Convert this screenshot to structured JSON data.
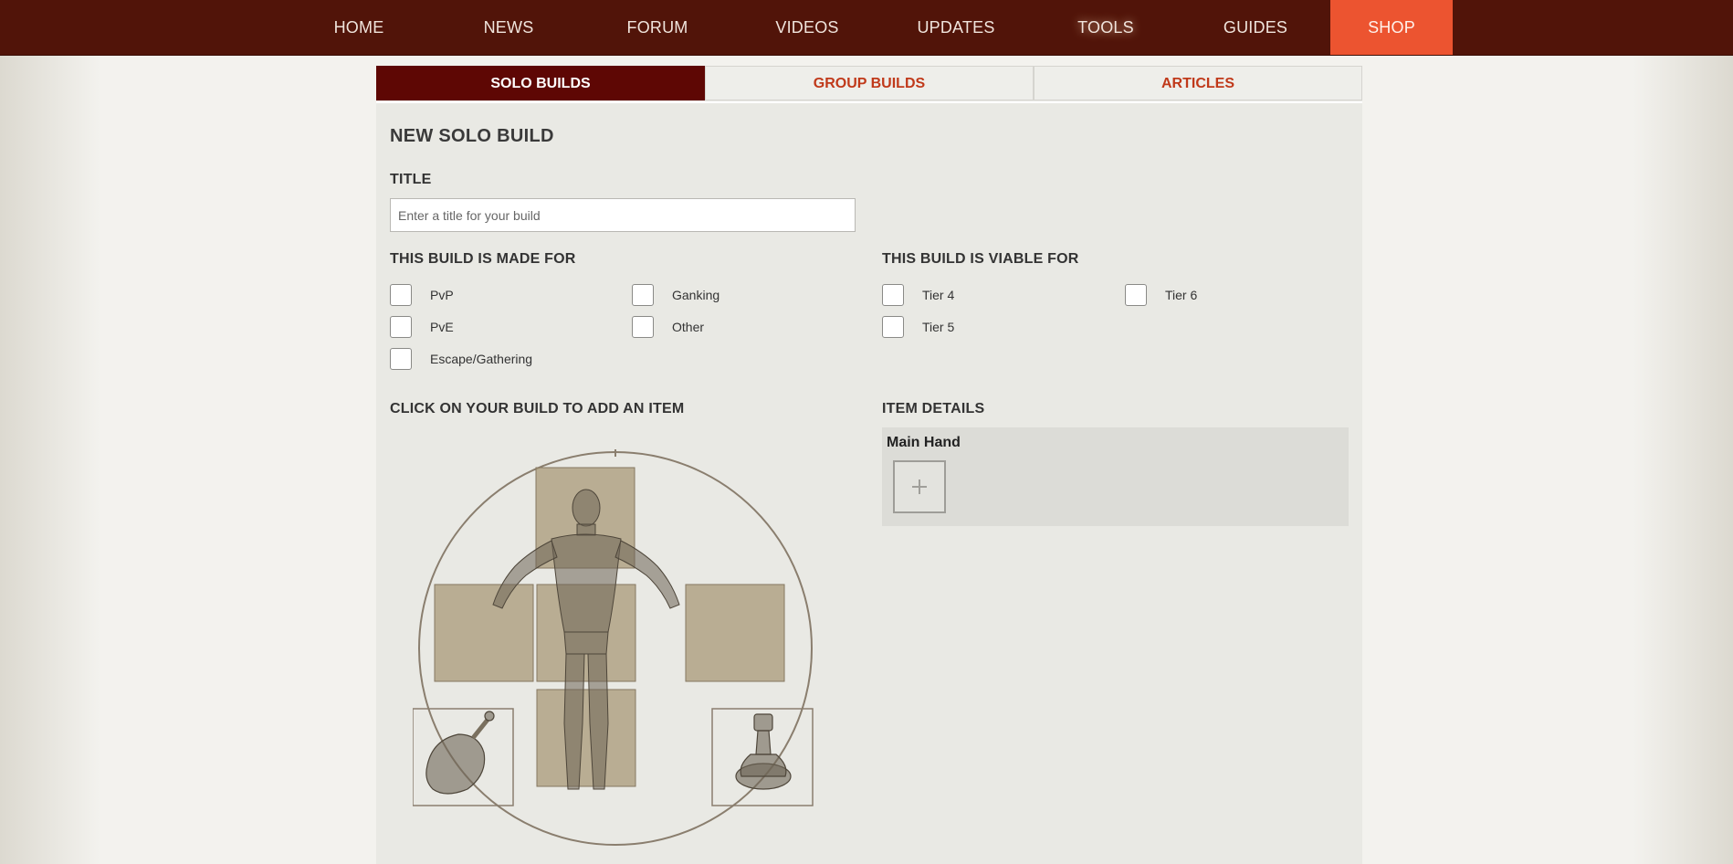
{
  "nav": {
    "items": [
      "HOME",
      "NEWS",
      "FORUM",
      "VIDEOS",
      "UPDATES",
      "TOOLS",
      "GUIDES"
    ],
    "shop": "SHOP",
    "active": "TOOLS"
  },
  "tabs": [
    "SOLO BUILDS",
    "GROUP BUILDS",
    "ARTICLES"
  ],
  "form": {
    "heading": "NEW SOLO BUILD",
    "title_label": "TITLE",
    "title_placeholder": "Enter a title for your build",
    "title_value": "",
    "made_for_label": "THIS BUILD IS MADE FOR",
    "made_for": [
      "PvP",
      "Ganking",
      "PvE",
      "Other",
      "Escape/Gathering"
    ],
    "viable_for_label": "THIS BUILD IS VIABLE FOR",
    "viable_for": [
      "Tier 4",
      "Tier 6",
      "Tier 5"
    ],
    "click_label": "CLICK ON YOUR BUILD TO ADD AN ITEM",
    "details_label": "ITEM DETAILS",
    "details_slot": "Main Hand",
    "add_icon": "plus-icon"
  },
  "colors": {
    "nav_bg": "#511409",
    "shop_bg": "#ec5430",
    "tab_active": "#5e0704",
    "tab_text": "#c0391a"
  }
}
